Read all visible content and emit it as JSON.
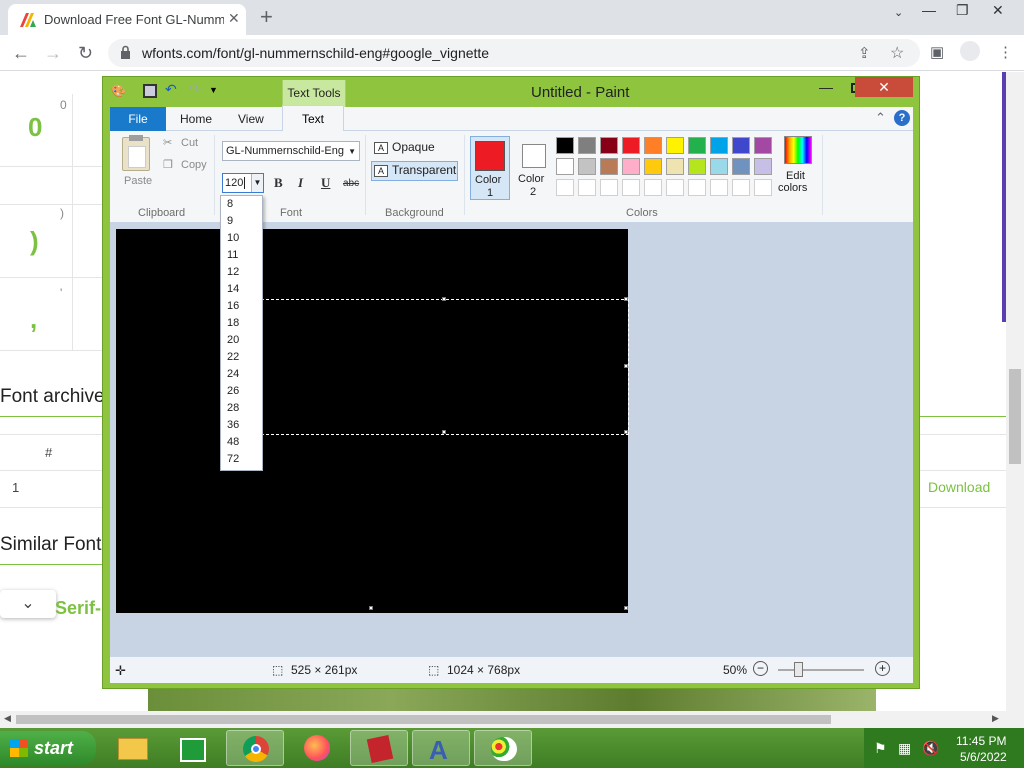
{
  "browser": {
    "tab_title": "Download Free Font GL-Numme",
    "url": "wfonts.com/font/gl-nummernschild-eng#google_vignette"
  },
  "page": {
    "glyphs": [
      {
        "char": "0",
        "label": "0"
      },
      {
        "char": ")",
        "label": ")"
      },
      {
        "char": ",",
        "label": "'"
      }
    ],
    "font_archive_heading": "Font archive",
    "table_hash": "#",
    "table_row_num": "1",
    "download_link": "Download",
    "similar_heading": "Similar Font",
    "similar_item": "Serif-"
  },
  "paint": {
    "window_title": "Untitled - Paint",
    "context_tab": "Text Tools",
    "tabs": {
      "file": "File",
      "home": "Home",
      "view": "View",
      "text": "Text"
    },
    "clipboard": {
      "paste": "Paste",
      "cut": "Cut",
      "copy": "Copy",
      "group": "Clipboard"
    },
    "font": {
      "family": "GL-Nummernschild-Eng",
      "size": "120",
      "bold": "B",
      "italic": "I",
      "underline": "U",
      "strike": "abc",
      "group": "Font"
    },
    "background": {
      "opaque": "Opaque",
      "transparent": "Transparent",
      "group": "Background"
    },
    "colors": {
      "color1_label": "Color\n1",
      "color1_a": "Color",
      "color1_b": "1",
      "color2_a": "Color",
      "color2_b": "2",
      "edit_a": "Edit",
      "edit_b": "colors",
      "group": "Colors",
      "color1": "#ed1c24",
      "color2": "#ffffff",
      "row1": [
        "#000000",
        "#7f7f7f",
        "#880015",
        "#ed1c24",
        "#ff7f27",
        "#fff200",
        "#22b14c",
        "#00a2e8",
        "#3f48cc",
        "#a349a4"
      ],
      "row2": [
        "#ffffff",
        "#c3c3c3",
        "#b97a57",
        "#ffaec9",
        "#ffc90e",
        "#efe4b0",
        "#b5e61d",
        "#99d9ea",
        "#7092be",
        "#c8bfe7"
      ]
    },
    "size_options": [
      "8",
      "9",
      "10",
      "11",
      "12",
      "14",
      "16",
      "18",
      "20",
      "22",
      "24",
      "26",
      "28",
      "36",
      "48",
      "72"
    ],
    "status": {
      "selection": "525 × 261px",
      "canvas": "1024 × 768px",
      "zoom": "50%"
    }
  },
  "taskbar": {
    "start": "start",
    "time": "11:45 PM",
    "date": "5/6/2022"
  }
}
